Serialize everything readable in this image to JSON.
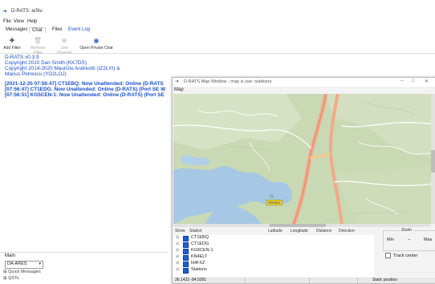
{
  "app": {
    "title": "D-RATS: ar5tu"
  },
  "menubar": [
    "File",
    "View",
    "Help"
  ],
  "tabs": [
    "Messages",
    "Chat",
    "Files",
    "Event Log"
  ],
  "toolbar": {
    "add_filter": "Add Filter",
    "remove_filter": "Remove Filter",
    "join_channel": "Join Channel",
    "open_private_chat": "Open Private Chat"
  },
  "log": {
    "lines": [
      "D-RATS v0.3.9",
      "Copyright 2010 Dan Smith (KK7DS)",
      "Copyright 2014-2020 Maurizio Andreotti (IZ2LXI) &",
      "Marius Petrescu (YO2LOJ)"
    ],
    "events": [
      "[2021-12-25 07:56:47] CT1EBQ: Now Unattended: Online (D-RATS",
      "[07:56:47] CT1EDG: Now Unattended: Online (D-RATS) (Port SE W",
      "[07:56:51] KG5CEN-1: Now Unattended: Online (D-RATS) (Port SE"
    ]
  },
  "bottom": {
    "main_label": "Main",
    "channel_value": "DA-ARES",
    "quick_messages": "Quick Messages",
    "qsts": "QSTs"
  },
  "map": {
    "title": "D-RATS Map Window - map is use: outdoors",
    "menu": "Map",
    "marker_label": "W5NEZ",
    "headers": [
      "Show",
      "Station",
      "Latitude",
      "Longitude",
      "Distance",
      "Direction"
    ],
    "stations": [
      "CT1EBQ",
      "CT1EDG",
      "KG5CEN-1",
      "KN4ELT",
      "N4FXZ",
      "Stations"
    ],
    "zoom_title": "Zoom",
    "zoom_min": "Min",
    "zoom_max": "Max",
    "track_center": "Track center",
    "status_left": "36.1422 -84.5991",
    "status_right": "Static position"
  },
  "colors": {
    "accent": "#1a5fd6",
    "log_text": "#1a4fd0"
  }
}
